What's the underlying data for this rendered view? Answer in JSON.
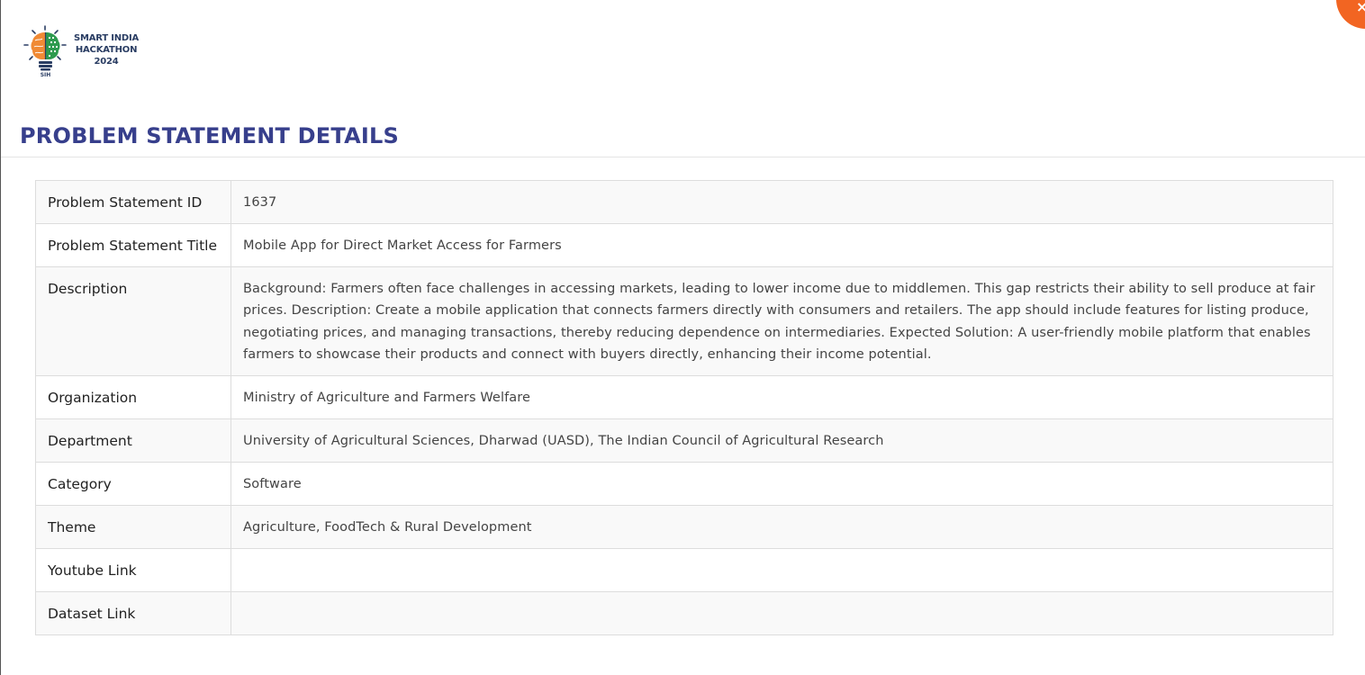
{
  "logo": {
    "line1": "SMART INDIA",
    "line2": "HACKATHON",
    "line3": "2024",
    "badge": "SIH"
  },
  "close_button": {
    "icon": "close-icon",
    "glyph": "×",
    "color": "#f26522"
  },
  "page_title": "PROBLEM STATEMENT DETAILS",
  "colors": {
    "title": "#373f8c",
    "accent": "#f26522",
    "logo_orange": "#f08a35",
    "logo_green": "#2e9a4f"
  },
  "details": {
    "id": {
      "label": "Problem Statement ID",
      "value": "1637"
    },
    "title": {
      "label": "Problem Statement Title",
      "value": "Mobile App for Direct Market Access for Farmers"
    },
    "description": {
      "label": "Description",
      "value": "Background: Farmers often face challenges in accessing markets, leading to lower income due to middlemen. This gap restricts their ability to sell produce at fair prices. Description: Create a mobile application that connects farmers directly with consumers and retailers. The app should include features for listing produce, negotiating prices, and managing transactions, thereby reducing dependence on intermediaries. Expected Solution: A user-friendly mobile platform that enables farmers to showcase their products and connect with buyers directly, enhancing their income potential."
    },
    "organization": {
      "label": "Organization",
      "value": "Ministry of Agriculture and Farmers Welfare"
    },
    "department": {
      "label": "Department",
      "value": "University of Agricultural Sciences, Dharwad (UASD), The Indian Council of Agricultural Research"
    },
    "category": {
      "label": "Category",
      "value": "Software"
    },
    "theme": {
      "label": "Theme",
      "value": "Agriculture, FoodTech & Rural Development"
    },
    "youtube": {
      "label": "Youtube Link",
      "value": ""
    },
    "dataset": {
      "label": "Dataset Link",
      "value": ""
    }
  }
}
